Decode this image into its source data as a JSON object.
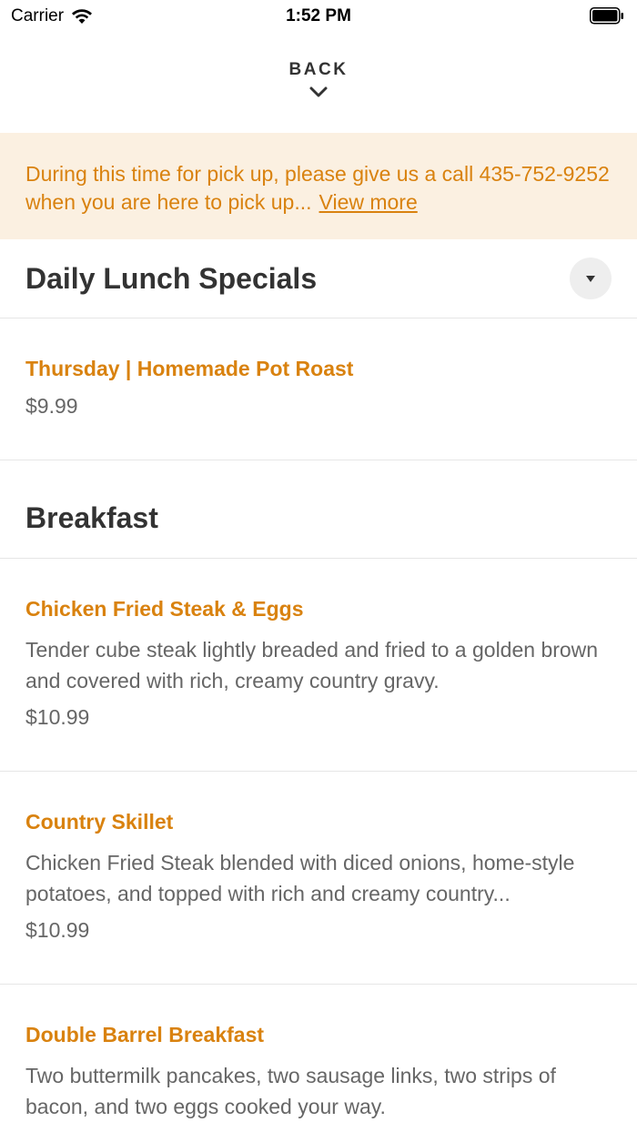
{
  "status_bar": {
    "carrier": "Carrier",
    "time": "1:52 PM"
  },
  "header": {
    "back_label": "BACK"
  },
  "notice": {
    "text": "During this time for pick up, please give us a call 435-752-9252 when you are here to pick up...",
    "link_label": "View more"
  },
  "sections": [
    {
      "title": "Daily Lunch Specials",
      "items": [
        {
          "name": "Thursday | Homemade Pot Roast",
          "description": "",
          "price": "$9.99"
        }
      ]
    },
    {
      "title": "Breakfast",
      "items": [
        {
          "name": "Chicken Fried Steak & Eggs",
          "description": "Tender cube steak lightly breaded and fried to a golden brown and covered with rich, creamy country gravy.",
          "price": "$10.99"
        },
        {
          "name": "Country Skillet",
          "description": "Chicken Fried Steak blended with diced onions, home-style potatoes, and topped with rich and creamy country...",
          "price": "$10.99"
        },
        {
          "name": "Double Barrel Breakfast",
          "description": "Two buttermilk pancakes, two sausage links, two strips of bacon, and two eggs cooked your way.",
          "price": ""
        }
      ]
    }
  ],
  "colors": {
    "accent": "#d9820f",
    "banner_bg": "#fbf0e1",
    "text_dark": "#333333",
    "text_muted": "#666666"
  }
}
